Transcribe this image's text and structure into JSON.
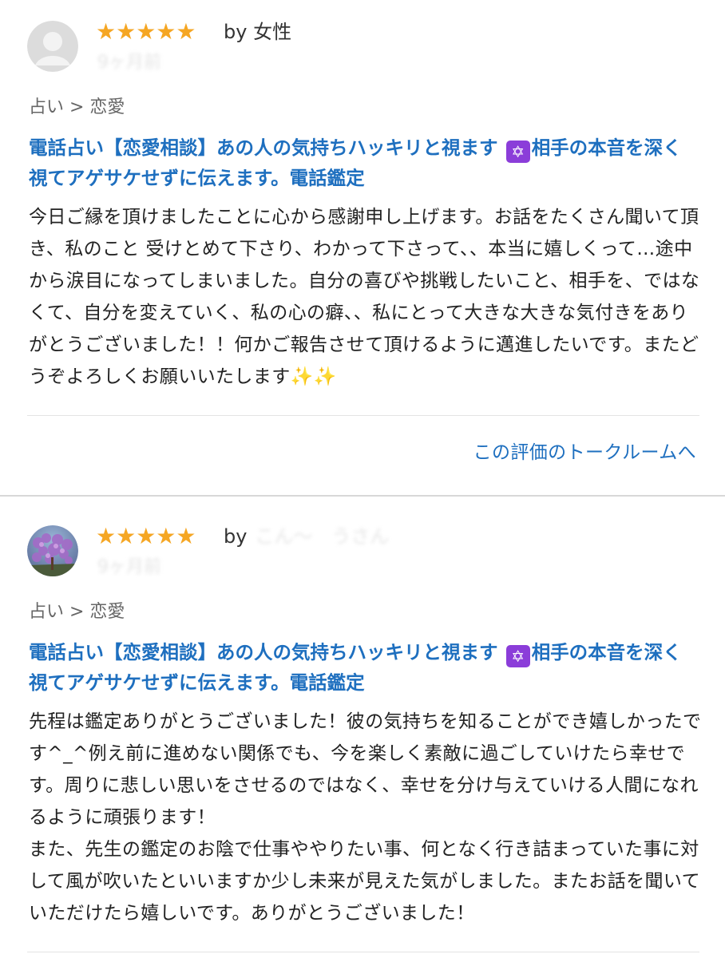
{
  "reviews": [
    {
      "rating": 5,
      "stars": "★★★★★",
      "by_label": "by",
      "reviewer": "女性",
      "date": "9ヶ月前",
      "category": "占い > 恋愛",
      "title_part1": "電話占い【恋愛相談】あの人の気持ちハッキリと視ます",
      "title_icon": "six-pointed-star-icon",
      "title_icon_glyph": "✡",
      "title_part2": "相手の本音を深く視てアゲサケせずに伝えます。電話鑑定",
      "body": "今日ご縁を頂けましたことに心から感謝申し上げます。お話をたくさん聞いて頂き、私のこと 受けとめて下さり、わかって下さって、、本当に嬉しくって…途中から涙目になってしまいました。自分の喜びや挑戦したいこと、相手を、ではなくて、自分を変えていく、私の心の癖、、私にとって大きな大きな気付きをありがとうございました！！何かご報告させて頂けるように邁進したいです。またどうぞよろしくお願いいたします✨✨",
      "talk_link": "この評価のトークルームへ"
    },
    {
      "rating": 5,
      "stars": "★★★★★",
      "by_label": "by",
      "reviewer": "こん〜　うさん",
      "date": "9ヶ月前",
      "category": "占い > 恋愛",
      "title_part1": "電話占い【恋愛相談】あの人の気持ちハッキリと視ます",
      "title_icon": "six-pointed-star-icon",
      "title_icon_glyph": "✡",
      "title_part2": "相手の本音を深く視てアゲサケせずに伝えます。電話鑑定",
      "body": "先程は鑑定ありがとうございました！彼の気持ちを知ることができ嬉しかったです^_^例え前に進めない関係でも、今を楽しく素敵に過ごしていけたら幸せです。周りに悲しい思いをさせるのではなく、幸せを分け与えていける人間になれるように頑張ります！\nまた、先生の鑑定のお陰で仕事ややりたい事、何となく行き詰まっていた事に対して風が吹いたといいますか少し未来が見えた気がしました。またお話を聞いていただけたら嬉しいです。ありがとうございました！"
    }
  ],
  "colors": {
    "star": "#f5a623",
    "link": "#1e6fbf",
    "badge": "#8b3dd9"
  }
}
